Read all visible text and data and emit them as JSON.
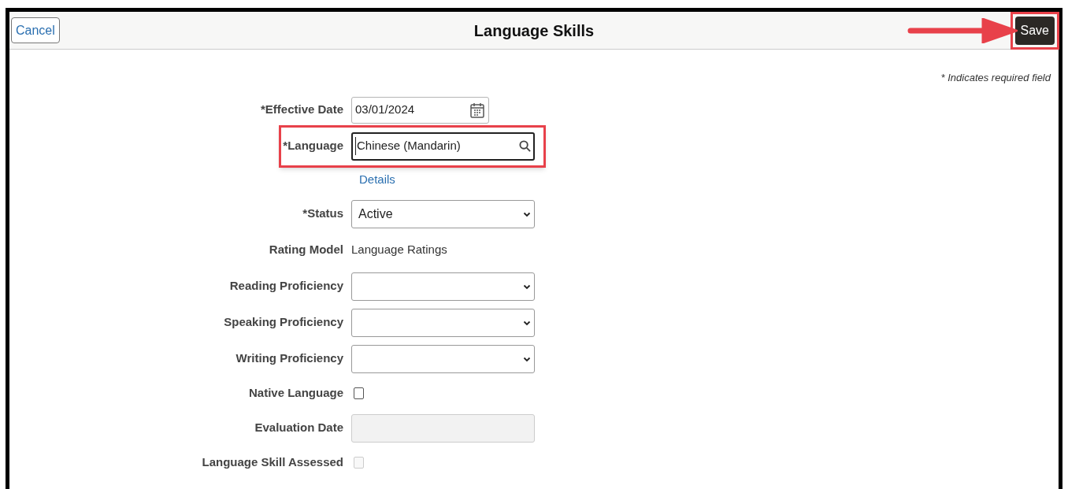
{
  "header": {
    "cancel": "Cancel",
    "title": "Language Skills",
    "save": "Save",
    "save_highlighted": true
  },
  "required_note": "* Indicates required field",
  "fields": [
    {
      "kind": "date",
      "label": "*Effective Date",
      "value": "03/01/2024",
      "highlighted": false
    },
    {
      "kind": "lookup",
      "label": "*Language",
      "value": "Chinese (Mandarin)",
      "highlighted": true,
      "link": "Details"
    },
    {
      "kind": "select",
      "label": "*Status",
      "value": "Active"
    },
    {
      "kind": "text",
      "label": "Rating Model",
      "value": "Language Ratings"
    },
    {
      "kind": "select",
      "label": "Reading Proficiency"
    },
    {
      "kind": "select",
      "label": "Speaking Proficiency"
    },
    {
      "kind": "select",
      "label": "Writing Proficiency"
    },
    {
      "kind": "checkbox",
      "label": "Native Language",
      "checked": false,
      "disabled": false
    },
    {
      "kind": "input",
      "label": "Evaluation Date",
      "disabled": true
    },
    {
      "kind": "checkbox",
      "label": "Language Skill Assessed",
      "checked": false,
      "disabled": true
    }
  ]
}
